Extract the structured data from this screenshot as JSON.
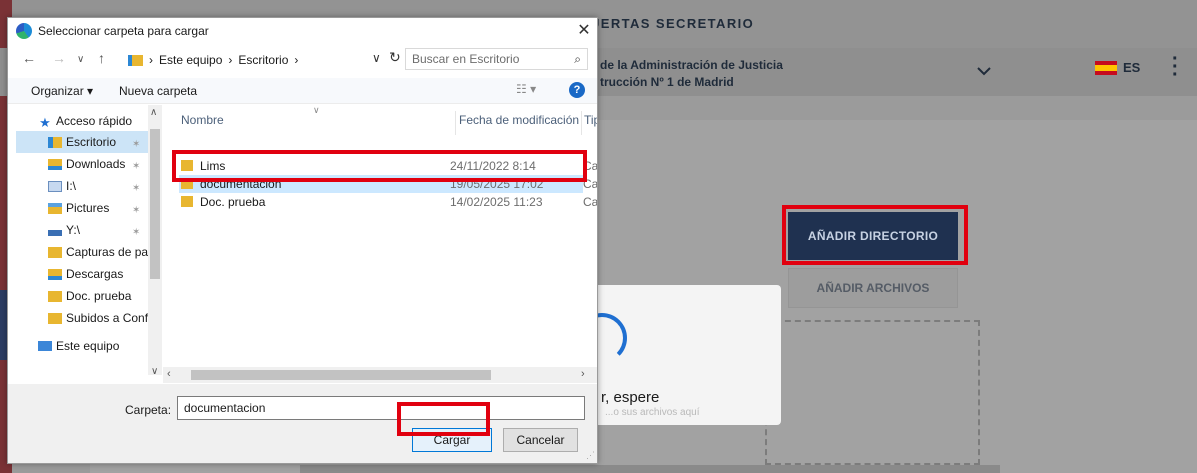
{
  "app": {
    "header_title": "UERTAS SECRETARIO",
    "org_line1": "de la Administración de Justicia",
    "org_line2": "trucción Nº 1 de Madrid",
    "language": "ES",
    "add_directory_label": "AÑADIR DIRECTORIO",
    "add_files_label": "AÑADIR ARCHIVOS",
    "wait_text": "r, espere",
    "wait_subtext": "...o sus archivos aquí"
  },
  "dialog": {
    "title": "Seleccionar carpeta para cargar",
    "close_glyph": "✕",
    "breadcrumb": [
      "Este equipo",
      "Escritorio"
    ],
    "search_placeholder": "Buscar en Escritorio",
    "toolbar": {
      "organize_label": "Organizar ▾",
      "new_folder_label": "Nueva carpeta",
      "help_glyph": "?"
    },
    "nav_pane": {
      "items": [
        {
          "label": "Acceso rápido",
          "icon": "star-icon"
        },
        {
          "label": "Escritorio",
          "icon": "desktop-folder-icon",
          "pinned": true,
          "selected": true
        },
        {
          "label": "Downloads",
          "icon": "downloads-folder-icon",
          "pinned": true
        },
        {
          "label": "I:\\",
          "icon": "drive-icon",
          "pinned": true
        },
        {
          "label": "Pictures",
          "icon": "pictures-folder-icon",
          "pinned": true
        },
        {
          "label": "Y:\\",
          "icon": "network-drive-icon",
          "pinned": true
        },
        {
          "label": "Capturas de pan",
          "icon": "folder-icon"
        },
        {
          "label": "Descargas",
          "icon": "downloads-folder-icon"
        },
        {
          "label": "Doc. prueba",
          "icon": "folder-icon"
        },
        {
          "label": "Subidos a Conflu",
          "icon": "folder-icon"
        },
        {
          "label": "Este equipo",
          "icon": "computer-icon"
        }
      ]
    },
    "columns": {
      "name": "Nombre",
      "modified": "Fecha de modificación",
      "type": "Tip"
    },
    "files": [
      {
        "name": "Lims",
        "modified": "24/11/2022 8:14",
        "type": "Car",
        "selected": false
      },
      {
        "name": "documentacion",
        "modified": "19/05/2025 17:02",
        "type": "Car",
        "selected": true
      },
      {
        "name": "Doc. prueba",
        "modified": "14/02/2025 11:23",
        "type": "Car",
        "selected": false
      }
    ],
    "folder_field_label": "Carpeta:",
    "folder_field_value": "documentacion",
    "upload_button": "Cargar",
    "cancel_button": "Cancelar"
  },
  "colors": {
    "highlight": "#e1000f",
    "primary_button": "#1f3150",
    "selection": "#cce8ff"
  }
}
